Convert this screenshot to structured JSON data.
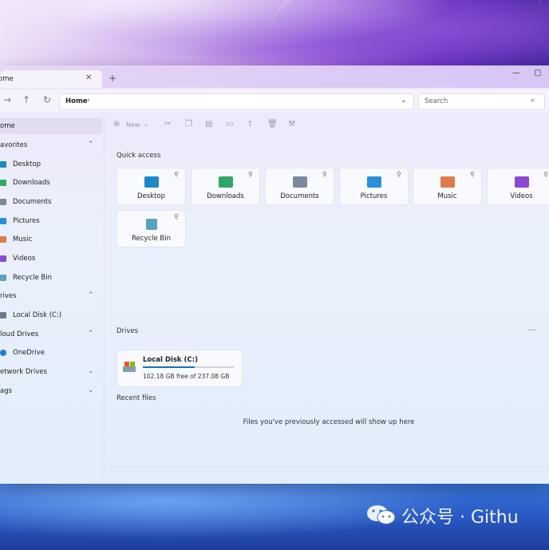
{
  "window": {
    "tab_title": "ome",
    "tab_close": "✕",
    "new_tab": "+",
    "minimize": "—",
    "maximize": "▢"
  },
  "toolbar": {
    "breadcrumb": "Home",
    "breadcrumb_sep": "›",
    "search_placeholder": "Search"
  },
  "sidebar": {
    "items": [
      {
        "label": "ome"
      },
      {
        "label": "avorites"
      },
      {
        "label": "Desktop"
      },
      {
        "label": "Downloads"
      },
      {
        "label": "Documents"
      },
      {
        "label": "Pictures"
      },
      {
        "label": "Music"
      },
      {
        "label": "Videos"
      },
      {
        "label": "Recycle Bin"
      },
      {
        "label": "rives"
      },
      {
        "label": "Local Disk (C:)"
      },
      {
        "label": "loud Drives"
      },
      {
        "label": "OneDrive"
      },
      {
        "label": "etwork Drives"
      },
      {
        "label": "ags"
      }
    ]
  },
  "commands": {
    "new_label": "New"
  },
  "main": {
    "quick_access_title": "Quick access",
    "quick_access": [
      {
        "label": "Desktop",
        "color": "#1e88c8"
      },
      {
        "label": "Downloads",
        "color": "#2fa866"
      },
      {
        "label": "Documents",
        "color": "#7a8a9a"
      },
      {
        "label": "Pictures",
        "color": "#2a8fd6"
      },
      {
        "label": "Music",
        "color": "#e07a4a"
      },
      {
        "label": "Videos",
        "color": "#8a4ad0"
      },
      {
        "label": "Recycle Bin",
        "color": "#5aa0c0"
      }
    ],
    "drives_title": "Drives",
    "drive": {
      "name": "Local Disk (C:)",
      "size_text": "102.18 GB free of 237.08 GB",
      "used_fraction": 0.57
    },
    "recent_title": "Recent files",
    "empty_message": "Files you've previously accessed will show up here",
    "more": "···"
  },
  "watermark": {
    "text": "公众号 · Githu"
  }
}
